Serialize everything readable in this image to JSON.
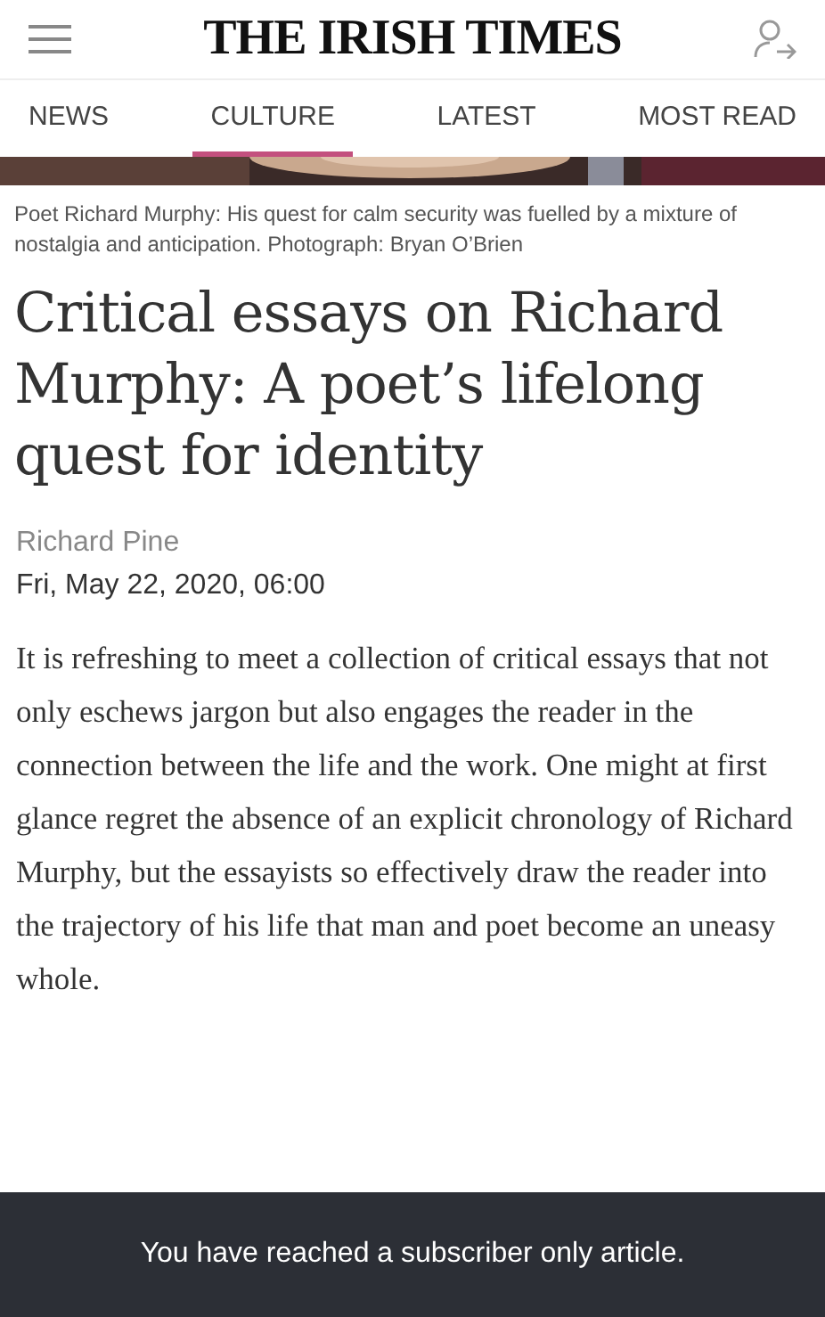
{
  "header": {
    "logo": "THE IRISH TIMES"
  },
  "tabs": [
    {
      "label": "NEWS",
      "selected": false
    },
    {
      "label": "CULTURE",
      "selected": true
    },
    {
      "label": "LATEST",
      "selected": false
    },
    {
      "label": "MOST READ",
      "selected": false
    }
  ],
  "caption": "Poet Richard Murphy: His quest for calm security was fuelled by a mixture of nostalgia and anticipation. Photograph: Bryan O’Brien",
  "headline": "Critical essays on Richard Murphy: A poet’s lifelong quest for identity",
  "author": "Richard Pine",
  "date": "Fri, May 22, 2020, 06:00",
  "body": "It is refreshing to meet a collection of critical essays that not only eschews jargon but also engages the reader in the connection between the life and the work. One might at first glance regret the absence of an explicit chronology of Richard Murphy, but the essayists so effectively draw the reader into the trajectory of his life that man and poet become an uneasy whole.",
  "paywall": {
    "message": "You have reached a subscriber only article."
  }
}
